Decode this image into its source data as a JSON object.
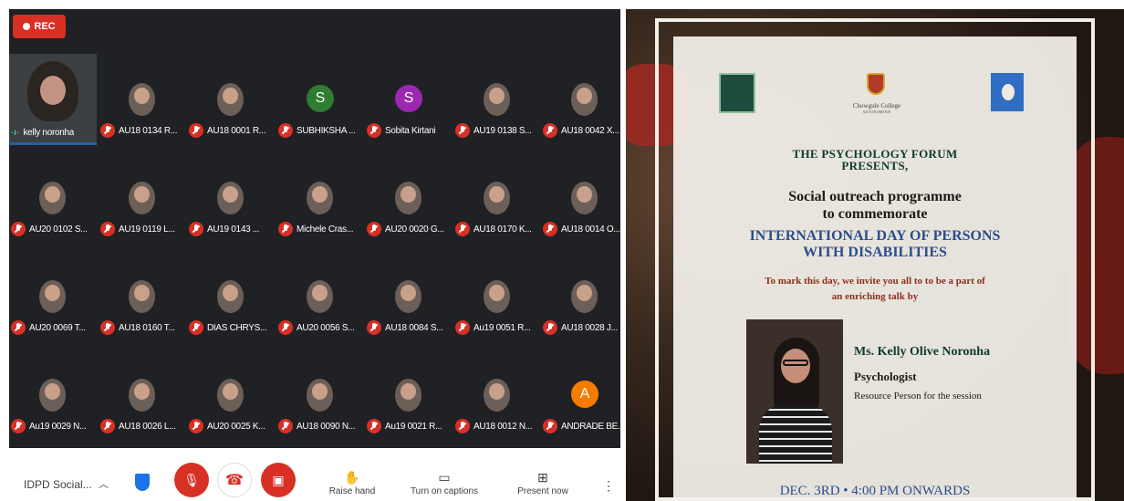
{
  "recording": {
    "label": "REC"
  },
  "participants": [
    {
      "name": "kelly noronha",
      "pinned": true
    },
    {
      "name": "AU18 0134 R..."
    },
    {
      "name": "AU18 0001 R..."
    },
    {
      "name": "SUBHIKSHA ...",
      "initial": "S",
      "color": "#2e7d32"
    },
    {
      "name": "Sobita Kirtani",
      "initial": "S",
      "color": "#9c27b0"
    },
    {
      "name": "AU19 0138 S..."
    },
    {
      "name": "AU18 0042 X..."
    },
    {
      "name": "AU20 0102 S..."
    },
    {
      "name": "AU19 0119 L..."
    },
    {
      "name": "AU19 0143 ..."
    },
    {
      "name": "Michele Cras..."
    },
    {
      "name": "AU20 0020 G..."
    },
    {
      "name": "AU18 0170 K..."
    },
    {
      "name": "AU18 0014 O..."
    },
    {
      "name": "AU20 0069 T..."
    },
    {
      "name": "AU18 0160 T..."
    },
    {
      "name": "DIAS CHRYS..."
    },
    {
      "name": "AU20 0056 S..."
    },
    {
      "name": "AU18 0084 S..."
    },
    {
      "name": "Au19 0051 R..."
    },
    {
      "name": "AU18 0028 J..."
    },
    {
      "name": "Au19 0029 N..."
    },
    {
      "name": "AU18 0026 L..."
    },
    {
      "name": "AU20 0025 K..."
    },
    {
      "name": "AU18 0090 N..."
    },
    {
      "name": "Au19 0021 R..."
    },
    {
      "name": "AU18 0012 N..."
    },
    {
      "name": "ANDRADE BE...",
      "initial": "A",
      "color": "#f57c00"
    }
  ],
  "toolbar": {
    "meeting_title": "IDPD Social...",
    "raise_hand": "Raise hand",
    "captions": "Turn on captions",
    "present": "Present now"
  },
  "poster": {
    "college_name": "Chowgule College",
    "college_sub": "AUTONOMOUS",
    "forum_line1": "THE PSYCHOLOGY FORUM",
    "forum_line2": "PRESENTS,",
    "programme_line1": "Social outreach programme",
    "programme_line2": "to commemorate",
    "event_line1": "INTERNATIONAL DAY OF PERSONS",
    "event_line2": "WITH DISABILITIES",
    "invite_line1": "To mark this day, we invite you all to to be a part of",
    "invite_line2": "an enriching talk by",
    "speaker_name": "Ms. Kelly Olive Noronha",
    "speaker_role": "Psychologist",
    "speaker_desc": "Resource Person for the session",
    "date_line": "DEC. 3RD • 4:00 PM ONWARDS"
  }
}
